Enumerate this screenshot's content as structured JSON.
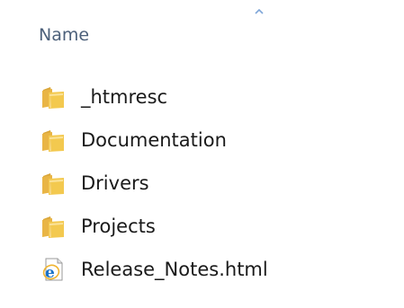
{
  "header": {
    "name_column": "Name"
  },
  "files": [
    {
      "name": "_htmresc",
      "icon": "folder-icon"
    },
    {
      "name": "Documentation",
      "icon": "folder-icon"
    },
    {
      "name": "Drivers",
      "icon": "folder-icon"
    },
    {
      "name": "Projects",
      "icon": "folder-icon"
    },
    {
      "name": "Release_Notes.html",
      "icon": "ie-html-file-icon"
    }
  ],
  "colors": {
    "header_text": "#4c607a",
    "item_text": "#1a1a1a",
    "folder_yellow": "#f3c94f",
    "sort_arrow": "#7fa6d8"
  }
}
